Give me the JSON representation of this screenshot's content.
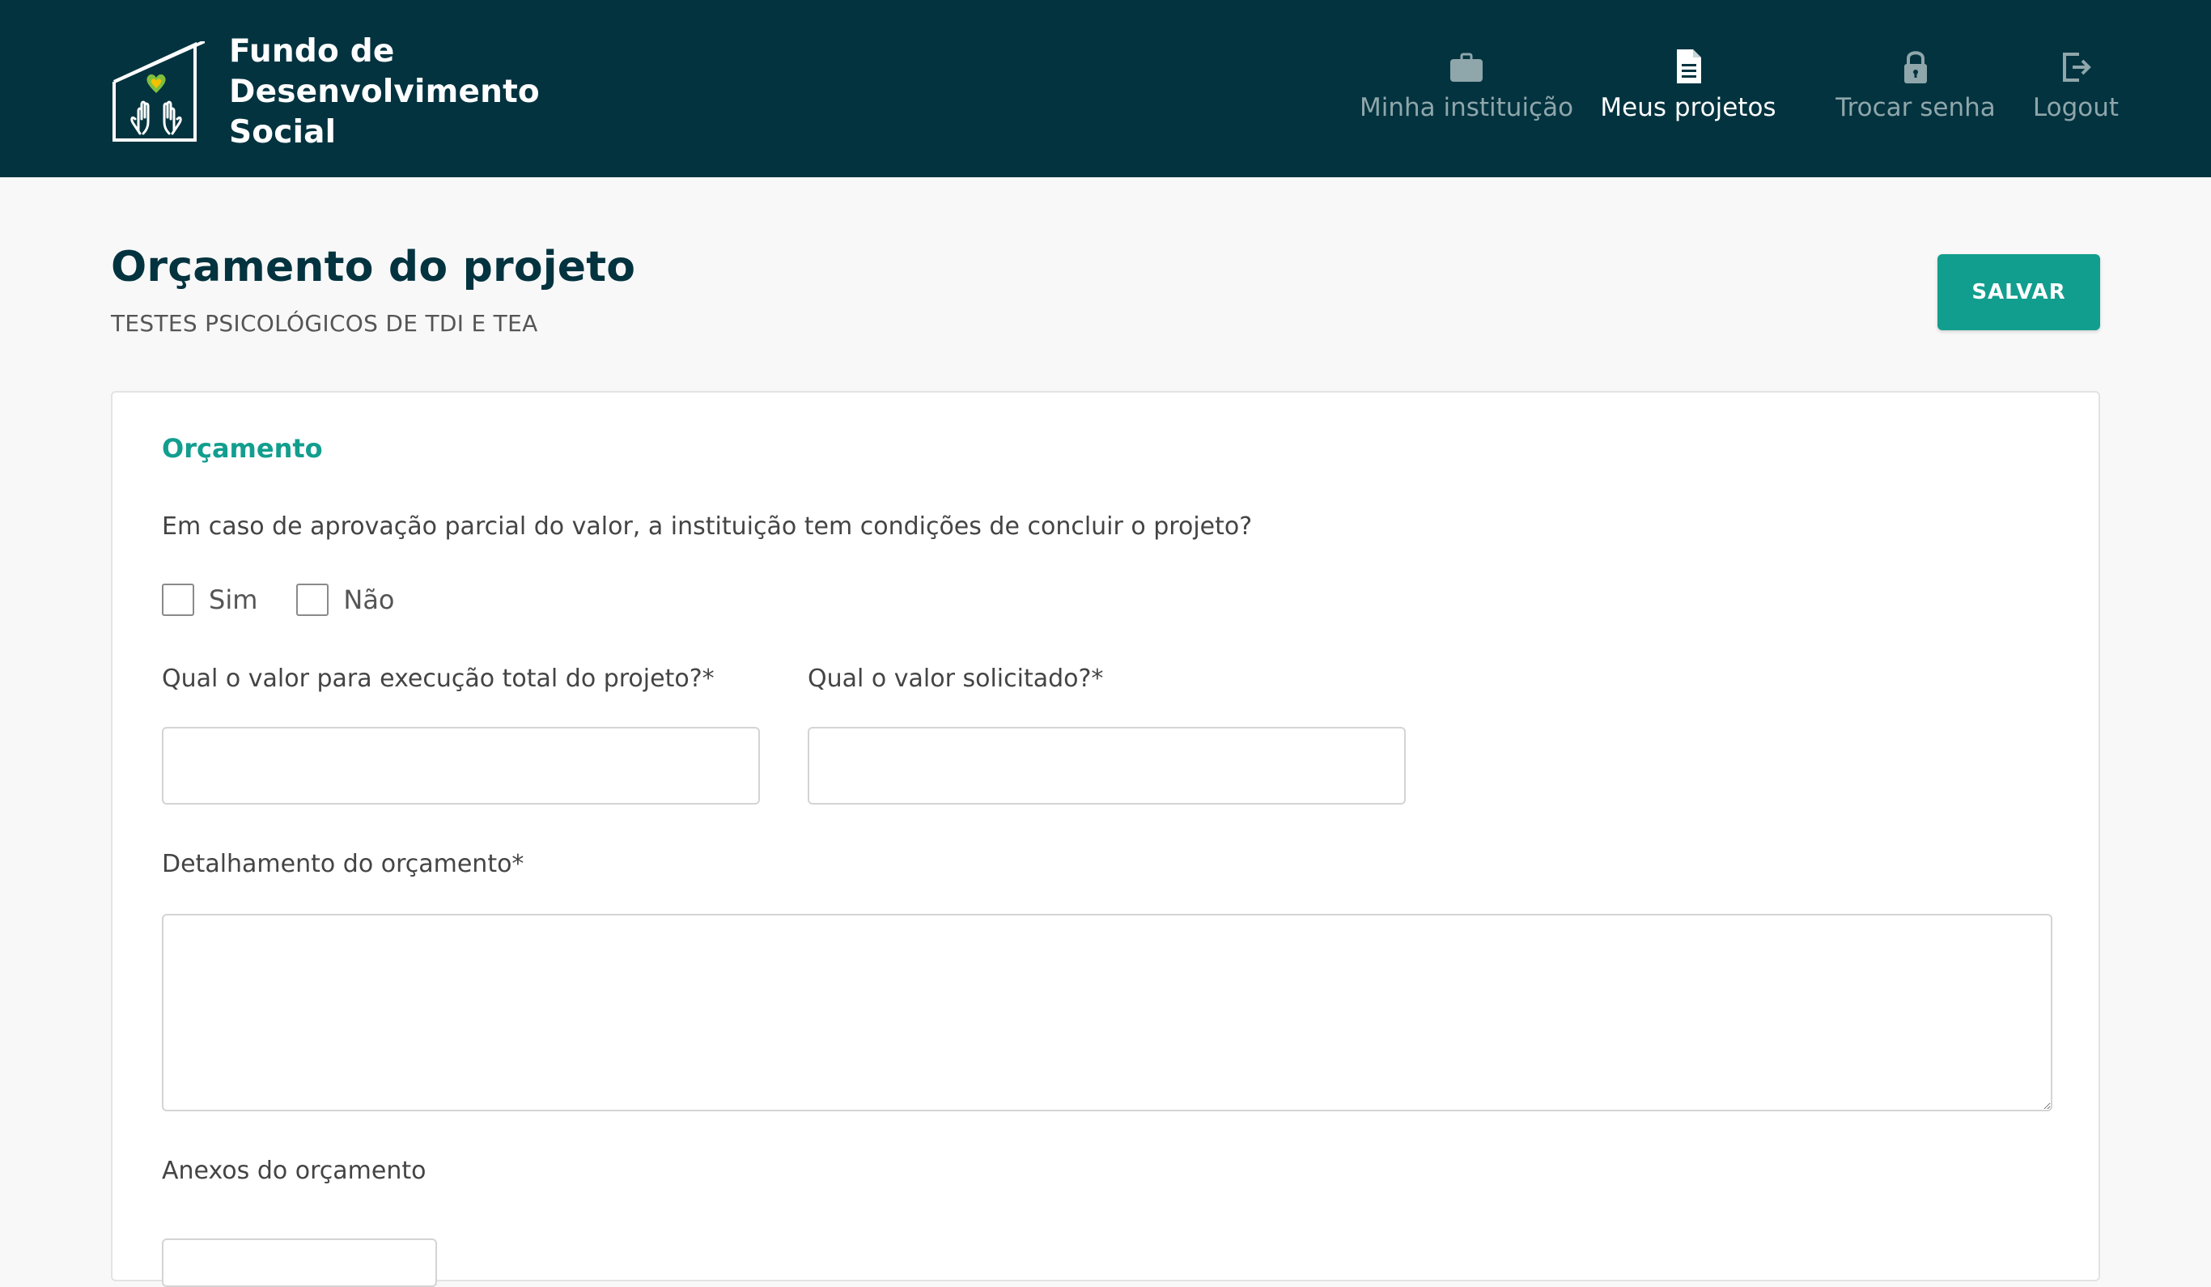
{
  "header": {
    "brand": {
      "name": "Fundo de\nDesenvolvimento\nSocial",
      "logo_icon": "house-hands-heart-icon"
    },
    "nav": [
      {
        "label": "Minha instituição",
        "icon": "briefcase-icon",
        "active": false
      },
      {
        "label": "Meus projetos",
        "icon": "document-icon",
        "active": true
      },
      {
        "label": "Trocar senha",
        "icon": "lock-icon",
        "active": false
      },
      {
        "label": "Logout",
        "icon": "logout-icon",
        "active": false
      }
    ]
  },
  "page": {
    "title": "Orçamento do projeto",
    "subtitle": "TESTES PSICOLÓGICOS DE TDI E TEA",
    "save_label": "SALVAR"
  },
  "form": {
    "section_title": "Orçamento",
    "question": "Em caso de aprovação parcial do valor, a instituição tem condições de concluir o projeto?",
    "options": [
      {
        "label": "Sim",
        "checked": false
      },
      {
        "label": "Não",
        "checked": false
      }
    ],
    "total_value_label": "Qual o valor para execução total do projeto?*",
    "total_value": "",
    "requested_value_label": "Qual o valor solicitado?*",
    "requested_value": "",
    "details_label": "Detalhamento do orçamento*",
    "details_value": "",
    "attachments_label": "Anexos do orçamento"
  },
  "colors": {
    "header_bg": "#02333f",
    "accent": "#129e8e",
    "nav_inactive": "#8fa6ab",
    "nav_active": "#ffffff",
    "page_bg": "#f8f8f8"
  }
}
